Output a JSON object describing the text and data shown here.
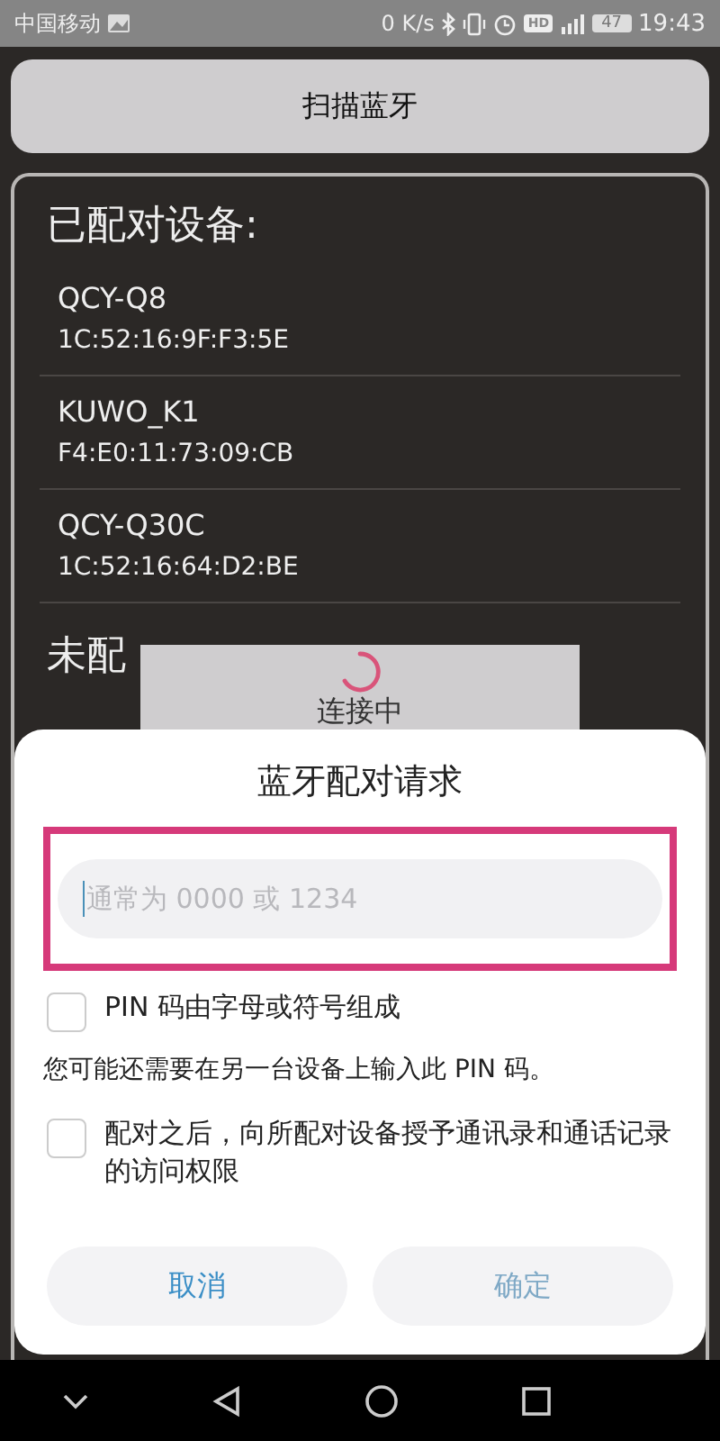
{
  "status_bar": {
    "carrier": "中国移动",
    "speed": "0 K/s",
    "hd": "HD",
    "battery": "47",
    "time": "19:43"
  },
  "scan_button": "扫描蓝牙",
  "paired": {
    "title": "已配对设备:",
    "devices": [
      {
        "name": "QCY-Q8",
        "address": "1C:52:16:9F:F3:5E"
      },
      {
        "name": "KUWO_K1",
        "address": "F4:E0:11:73:09:CB"
      },
      {
        "name": "QCY-Q30C",
        "address": "1C:52:16:64:D2:BE"
      }
    ]
  },
  "unpaired_title": "未配",
  "progress": {
    "message": "连接中"
  },
  "dialog": {
    "title": "蓝牙配对请求",
    "pin_field": {
      "placeholder": "通常为 0000 或 1234"
    },
    "items": [
      {
        "kind": "checkbox",
        "label": "PIN 码由字母或符号组成",
        "checked": false
      },
      {
        "kind": "note",
        "label": "您可能还需要在另一台设备上输入此 PIN 码。"
      },
      {
        "kind": "checkbox",
        "label": "配对之后，向所配对设备授予通讯录和通话记录的访问权限",
        "checked": false
      }
    ],
    "buttons": [
      {
        "label": "取消",
        "disabled": false
      },
      {
        "label": "确定",
        "disabled": true
      }
    ]
  }
}
